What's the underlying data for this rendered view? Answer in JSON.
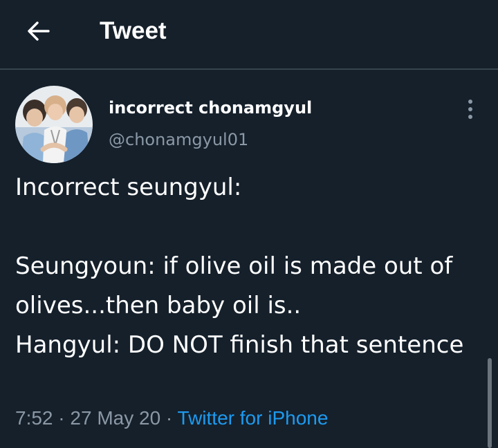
{
  "header": {
    "title": "Tweet",
    "back_icon": "arrow-left-icon"
  },
  "tweet": {
    "display_name": "incorrect chonamgyul",
    "handle": "@chonamgyul01",
    "text": "Incorrect seungyul:\n\nSeungyoun: if olive oil is made out of olives...then baby oil is..\nHangyul: DO NOT finish that sentence",
    "time": "7:52",
    "date": "27 May 20",
    "separator": " · ",
    "source": "Twitter for iPhone",
    "more_icon": "more-vertical-icon"
  },
  "colors": {
    "background": "#15202b",
    "text": "#ffffff",
    "secondary": "#8b98a5",
    "accent": "#1d9bf0",
    "divider": "#38444d"
  }
}
